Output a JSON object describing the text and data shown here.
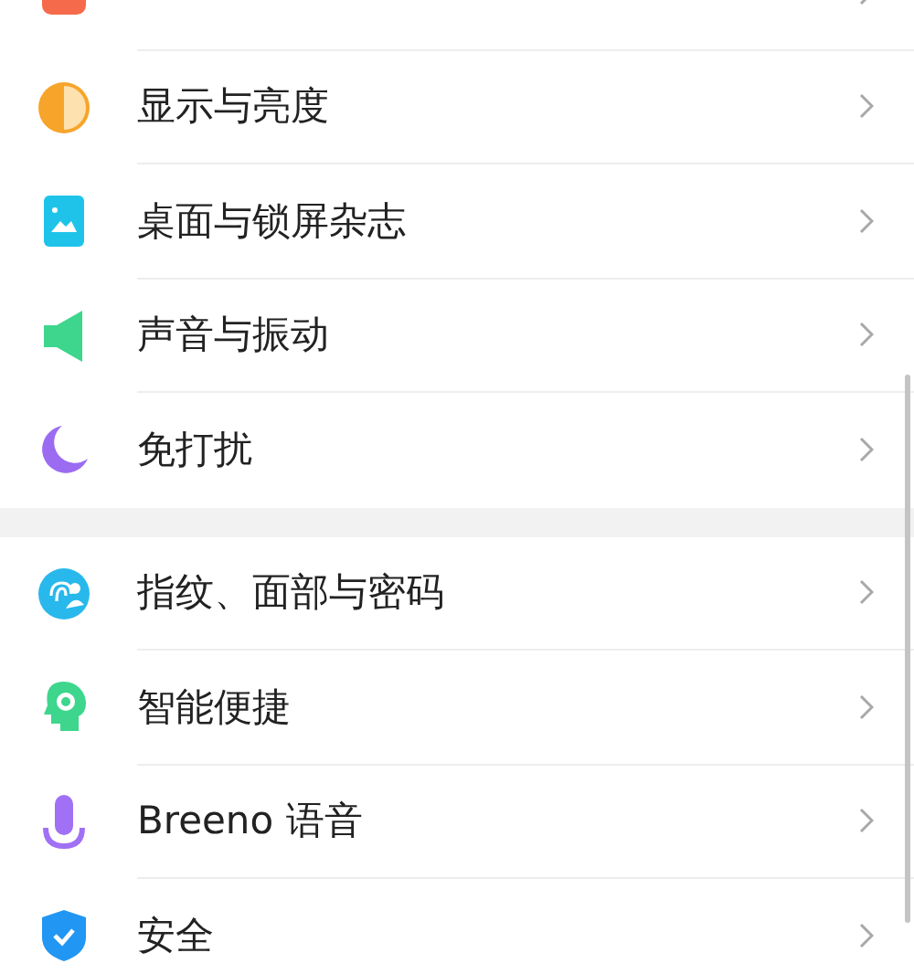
{
  "groups": [
    {
      "items": [
        {
          "label": "显示与亮度"
        },
        {
          "label": "桌面与锁屏杂志"
        },
        {
          "label": "声音与振动"
        },
        {
          "label": "免打扰"
        }
      ]
    },
    {
      "items": [
        {
          "label": "指纹、面部与密码"
        },
        {
          "label": "智能便捷"
        },
        {
          "label": "Breeno 语音"
        },
        {
          "label": "安全"
        }
      ]
    }
  ]
}
